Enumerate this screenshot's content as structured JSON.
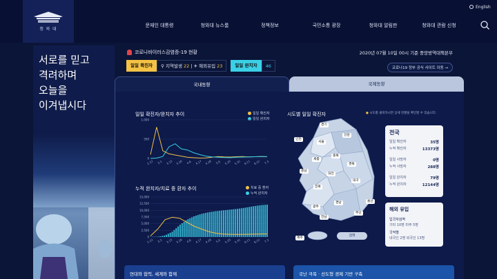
{
  "header": {
    "logo_text": "청 와 대",
    "english_label": "English",
    "nav": [
      "문재인 대통령",
      "청와대 뉴스룸",
      "정책정보",
      "국민소통 광장",
      "청와대 알림판",
      "청와대 관람 신청"
    ]
  },
  "hero": {
    "lines": [
      "서로를 믿고",
      "격려하며",
      "오늘을",
      "이겨냅시다"
    ]
  },
  "dashboard": {
    "title": "코로나바이러스감염증-19 현황",
    "date": "2020년 07월 10일 00시 기준 중앙방역대책본부",
    "daily_confirmed_label": "일일 확진자",
    "local_label": "지역발생",
    "local_value": "22",
    "imported_label": "해외유입",
    "imported_value": "23",
    "daily_released_label": "일일 완치자",
    "daily_released_value": "46",
    "site_button": "코로나19 정부 공식 사이트 이동",
    "tab_domestic": "국내동향",
    "tab_global": "국제동향"
  },
  "chart_data": [
    {
      "type": "line",
      "title": "일일 확진자/완치자 추이",
      "x": [
        "2.22",
        "3.6",
        "3.20",
        "4.3",
        "4.17",
        "5.1",
        "5.15",
        "5.29",
        "6.12",
        "6.26",
        "7.10"
      ],
      "tick_labels": [
        "2.22",
        "3.3",
        "3.15",
        "3.26",
        "4.6",
        "4.17",
        "4.28",
        "5.9",
        "5.20",
        "5.31",
        "6.11",
        "6.22",
        "7.3"
      ],
      "ylim": [
        0,
        1000
      ],
      "yticks": [
        "0",
        "500",
        "1,000"
      ],
      "series": [
        {
          "name": "일일 확진자",
          "color": "#f4c244",
          "values": [
            100,
            813,
            200,
            120,
            90,
            60,
            30,
            20,
            10,
            15,
            30,
            50,
            40,
            35,
            45,
            50,
            40,
            45,
            50,
            45
          ]
        },
        {
          "name": "일일 완치자",
          "color": "#3ad0e6",
          "values": [
            0,
            10,
            50,
            300,
            380,
            250,
            220,
            150,
            100,
            60,
            40,
            30,
            25,
            20,
            30,
            35,
            40,
            45,
            50,
            46
          ]
        }
      ]
    },
    {
      "type": "bar+line",
      "title": "누적 완치자/치료 중 환자 추이",
      "tick_labels": [
        "2.22",
        "3.3",
        "3.15",
        "3.26",
        "4.6",
        "4.17",
        "4.28",
        "5.9",
        "5.20",
        "5.31",
        "6.11",
        "6.22",
        "7.3"
      ],
      "ylim": [
        0,
        15000
      ],
      "yticks": [
        "0",
        "2,500",
        "5,000",
        "7,500",
        "10,000",
        "12,500",
        "15,000"
      ],
      "series": [
        {
          "name": "치료 중 환자",
          "color": "#f4c244",
          "values": [
            400,
            3000,
            6500,
            7400,
            7000,
            5500,
            4000,
            3000,
            2000,
            1400,
            1100,
            1000,
            950,
            1000,
            1050,
            1100,
            1150
          ]
        },
        {
          "name": "누적 완치자",
          "color": "#3ad0e6",
          "values": [
            50,
            100,
            600,
            2000,
            4500,
            6500,
            7800,
            8700,
            9300,
            9700,
            10000,
            10300,
            10600,
            11000,
            11500,
            11900,
            12144
          ]
        }
      ]
    }
  ],
  "map": {
    "title": "시도별 일일 확진자",
    "note": "시도를 클릭하시면 상세 현황을 확인할 수 있습니다.",
    "regions": [
      "경기",
      "인천",
      "서울",
      "강원",
      "충북",
      "세종",
      "경북",
      "충남",
      "대전",
      "대구",
      "전북",
      "울산",
      "광주",
      "경남",
      "부산",
      "전남",
      "제주"
    ],
    "quarantine_button": "검역"
  },
  "nation_card": {
    "title": "전국",
    "rows": [
      {
        "label": "일일 확진자",
        "value": "35명"
      },
      {
        "label": "누적 확진자",
        "value": "13373명"
      },
      {
        "label": "일일 사망자",
        "value": "0명"
      },
      {
        "label": "누적 사망자",
        "value": "288명"
      },
      {
        "label": "일일 완치자",
        "value": "79명"
      },
      {
        "label": "누적 완치자",
        "value": "12144명"
      }
    ]
  },
  "abroad_card": {
    "title": "해외 유입",
    "entry_label": "입국자검역",
    "entry_values": "기타 10명   미주 5명",
    "local_label": "국적별",
    "local_values": "내국인 2명   외국인 13명"
  },
  "bottom": {
    "card_a": "연대와 협력, 세계와 함께",
    "card_b": "국난 극복 · 선도형 경제 기반 구축"
  }
}
